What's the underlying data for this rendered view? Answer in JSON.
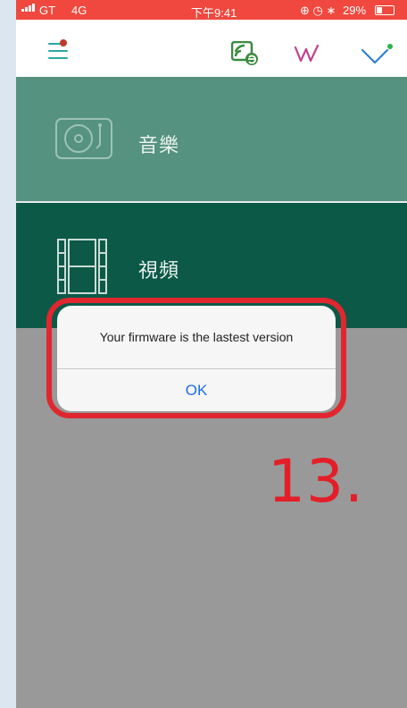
{
  "status_bar": {
    "carrier": "GT",
    "network": "4G",
    "time": "下午9:41",
    "battery_percent": "29%",
    "background_color": "#f0483e"
  },
  "toolbar": {
    "icons": [
      "menu-icon",
      "cast-icon",
      "w-logo-icon",
      "check-icon"
    ],
    "accent_color": "#2aa7a0"
  },
  "list": {
    "items": [
      {
        "label": "音樂",
        "icon": "turntable-icon",
        "color": "#55927f"
      },
      {
        "label": "視頻",
        "icon": "film-icon",
        "color": "#0c5948"
      }
    ]
  },
  "dialog": {
    "message": "Your firmware is the lastest version",
    "ok_label": "OK",
    "highlight_color": "#e0262e"
  },
  "annotation": {
    "step": "13."
  }
}
